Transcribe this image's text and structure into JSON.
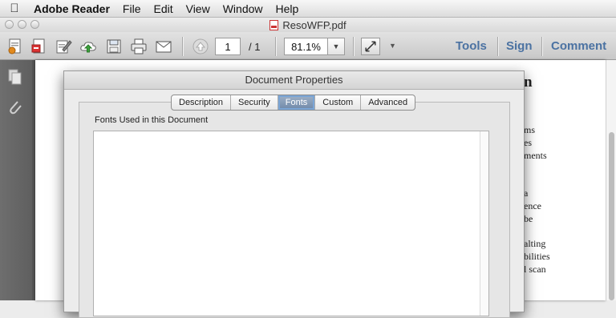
{
  "menubar": {
    "app_name": "Adobe Reader",
    "items": [
      "File",
      "Edit",
      "View",
      "Window",
      "Help"
    ]
  },
  "window": {
    "title": "ResoWFP.pdf"
  },
  "toolbar": {
    "page_current": "1",
    "page_total": "/ 1",
    "zoom": "81.1%",
    "tools_label": "Tools",
    "sign_label": "Sign",
    "comment_label": "Comment"
  },
  "page_fragments": {
    "heading": "n",
    "lines": [
      "ms",
      "es",
      "ments",
      "a",
      "ence",
      "be",
      "alting",
      "bilities",
      "l scan"
    ]
  },
  "dialog": {
    "title": "Document Properties",
    "tabs": [
      "Description",
      "Security",
      "Fonts",
      "Custom",
      "Advanced"
    ],
    "active_tab": "Fonts",
    "group_label": "Fonts Used in this Document"
  },
  "colors": {
    "accent_link": "#4b72a2",
    "active_tab": "#7a90ad"
  }
}
